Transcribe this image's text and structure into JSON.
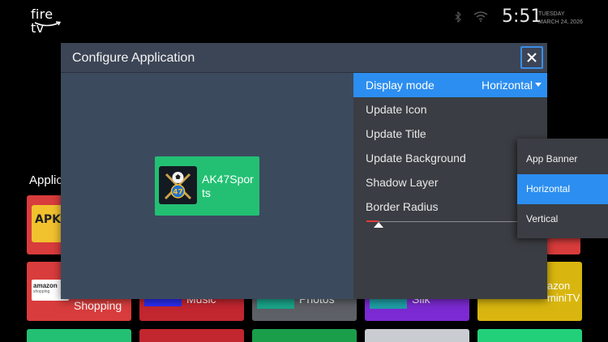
{
  "topbar": {
    "logo": "fire tv",
    "time": "5:51",
    "day": "TUESDAY",
    "date": "MARCH 24, 2026",
    "icons": [
      "bluetooth-icon",
      "wifi-icon"
    ]
  },
  "background": {
    "section_title": "Applic",
    "tiles": [
      {
        "name": "apk-tile",
        "label": "",
        "color": "#d93c3c"
      },
      {
        "name": "amazon-shopping-tile",
        "label": "Shopping",
        "color": "#d93c3c"
      },
      {
        "name": "music-tile",
        "label": "Music",
        "color": "#c2262f"
      },
      {
        "name": "photos-tile",
        "label": "Photos",
        "color": "#5d6066"
      },
      {
        "name": "silk-tile",
        "label": "Silk",
        "color": "#7c2ad2"
      },
      {
        "name": "amazon-minitv-tile",
        "label": "azon\nminiTV",
        "color": "#d9b60f"
      }
    ],
    "amazon_logo_text": "amazon",
    "amazon_logo_sub": "shopping"
  },
  "dialog": {
    "title": "Configure Application",
    "close_icon": "close-icon",
    "app_card": {
      "label": "AK47Sports",
      "badge": "47",
      "color": "#23c073"
    },
    "menu": {
      "items": [
        {
          "label": "Display mode",
          "value": "Horizontal"
        },
        {
          "label": "Update Icon"
        },
        {
          "label": "Update Title"
        },
        {
          "label": "Update Background"
        },
        {
          "label": "Shadow Layer"
        },
        {
          "label": "Border Radius"
        }
      ],
      "border_radius_fraction": 0.07
    }
  },
  "dropdown": {
    "options": [
      "App Banner",
      "Horizontal",
      "Vertical"
    ],
    "selected": "Horizontal"
  },
  "colors": {
    "accent": "#2c8ef0",
    "dialog_bg": "#3b4454",
    "menu_bg": "#3a3d43"
  }
}
